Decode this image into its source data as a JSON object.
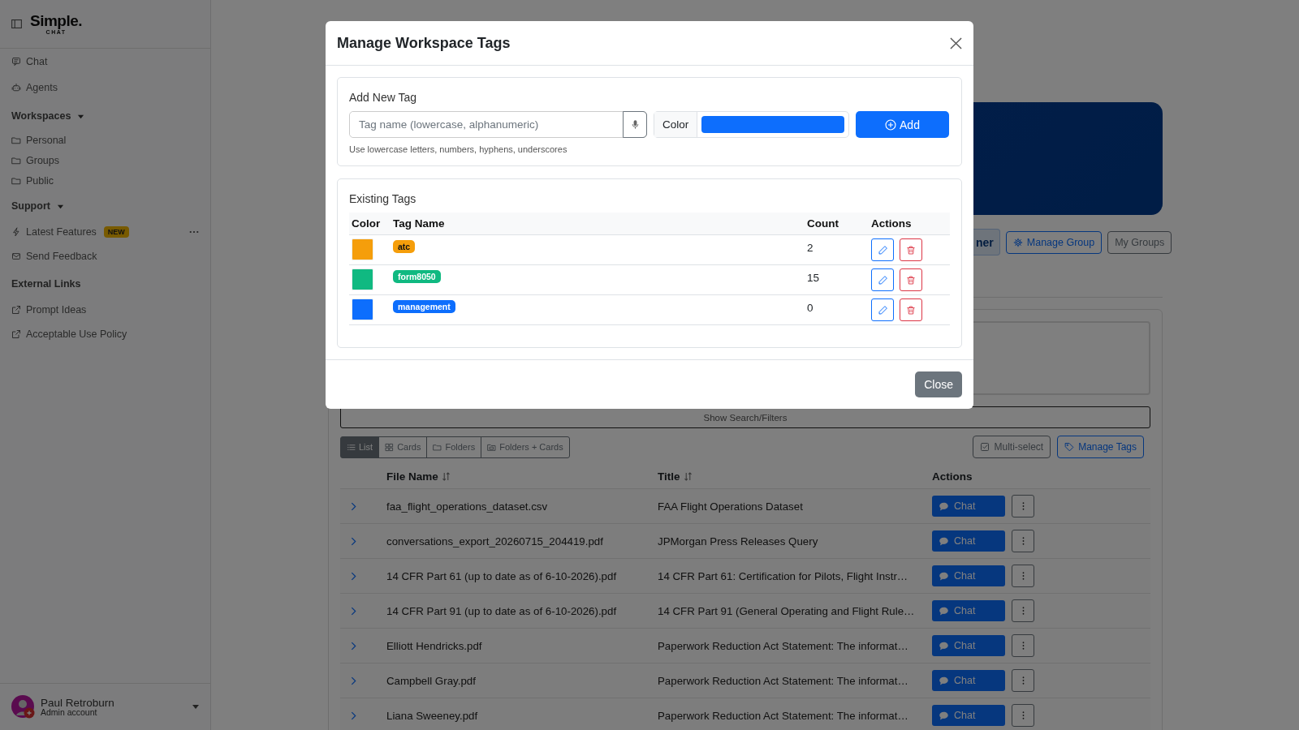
{
  "sidebar": {
    "logo": {
      "title": "Simple.",
      "subtitle": "CHAT"
    },
    "nav": [
      {
        "label": "Chat"
      },
      {
        "label": "Agents"
      }
    ],
    "sections": [
      {
        "title": "Workspaces",
        "expanded": true,
        "items": [
          {
            "label": "Personal"
          },
          {
            "label": "Groups"
          },
          {
            "label": "Public"
          }
        ]
      },
      {
        "title": "Support",
        "expanded": true,
        "items": [
          {
            "label": "Latest Features",
            "badge": "NEW",
            "has_menu": true
          },
          {
            "label": "Send Feedback",
            "has_menu": false
          }
        ]
      },
      {
        "title": "External Links",
        "items": [
          {
            "label": "Prompt Ideas"
          },
          {
            "label": "Acceptable Use Policy"
          }
        ]
      }
    ],
    "user": {
      "name": "Paul Retroburn",
      "role": "Admin account"
    }
  },
  "main": {
    "group_buttons": [
      {
        "label": "ner",
        "kind": "soft"
      },
      {
        "label": "Manage Group",
        "kind": "outline-primary"
      },
      {
        "label": "My Groups",
        "kind": "outline-secondary"
      }
    ],
    "filters_button": "Show Search/Filters",
    "view_modes": [
      {
        "label": "List",
        "selected": true
      },
      {
        "label": "Cards",
        "selected": false
      },
      {
        "label": "Folders",
        "selected": false
      },
      {
        "label": "Folders + Cards",
        "selected": false
      }
    ],
    "toolbar": [
      {
        "label": "Multi-select",
        "kind": "outline-secondary"
      },
      {
        "label": "Manage Tags",
        "kind": "outline-primary"
      }
    ],
    "documents": {
      "columns": [
        {
          "label": "File Name",
          "sortable": true
        },
        {
          "label": "Title",
          "sortable": true
        },
        {
          "label": "Actions",
          "sortable": false
        }
      ],
      "rows": [
        {
          "file_name": "faa_flight_operations_dataset.csv",
          "title": "FAA Flight Operations Dataset",
          "action": "Chat"
        },
        {
          "file_name": "conversations_export_20260715_204419.pdf",
          "title": "JPMorgan Press Releases Query",
          "action": "Chat"
        },
        {
          "file_name": "14 CFR Part 61 (up to date as of 6-10-2026).pdf",
          "title": "14 CFR Part 61: Certification for Pilots, Flight Instr…",
          "action": "Chat"
        },
        {
          "file_name": "14 CFR Part 91 (up to date as of 6-10-2026).pdf",
          "title": "14 CFR Part 91 (General Operating and Flight Rule…",
          "action": "Chat"
        },
        {
          "file_name": "Elliott Hendricks.pdf",
          "title": "Paperwork Reduction Act Statement: The informat…",
          "action": "Chat"
        },
        {
          "file_name": "Campbell Gray.pdf",
          "title": "Paperwork Reduction Act Statement: The informat…",
          "action": "Chat"
        },
        {
          "file_name": "Liana Sweeney.pdf",
          "title": "Paperwork Reduction Act Statement: The informat…",
          "action": "Chat"
        }
      ]
    }
  },
  "modal": {
    "title": "Manage Workspace Tags",
    "add_tag": {
      "heading": "Add New Tag",
      "name_placeholder": "Tag name (lowercase, alphanumeric)",
      "color_label": "Color",
      "color": "#0d6efd",
      "button": "Add",
      "hint": "Use lowercase letters, numbers, hyphens, underscores"
    },
    "existing": {
      "heading": "Existing Tags",
      "columns": [
        "Color",
        "Tag Name",
        "Count",
        "Actions"
      ],
      "tags": [
        {
          "name": "atc",
          "color": "#f59e0b",
          "count": "2"
        },
        {
          "name": "form8050",
          "color": "#10b981",
          "count": "15"
        },
        {
          "name": "management",
          "color": "#0d6efd",
          "count": "0"
        }
      ]
    },
    "close_button": "Close"
  }
}
